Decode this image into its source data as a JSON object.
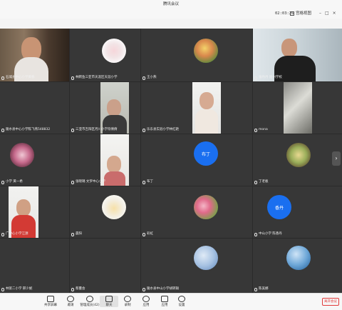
{
  "window": {
    "title": "腾讯会议"
  },
  "topbar": {
    "timer": "02:03:26",
    "view_label": "宫格视图"
  },
  "participants": {
    "r1c1": "石城县中心小学黄春",
    "r1c2": "林鳄鱼三亚市天涯区天涯小学",
    "r1c3": "王小燕",
    "r1c4": "张丹丹 崖州学校",
    "r2c1": "陵水县中心小学陈飞燕548832",
    "r2c2": "三亚市吉阳区月川小学符倩倩",
    "r2c3": "乐东县实验小学林红艳",
    "r2c4": "mona",
    "r3c1": "小学 黄一希",
    "r3c2": "张晓璐 文罗中心小学",
    "r3c3": "布丁",
    "r3c4": "丁老板",
    "r4c1": "广中心小学江源",
    "r4c2": "晨阳",
    "r4c3": "彩虹",
    "r4c4": "中山小学 陈香丹",
    "r5c1": "林第二小学 邢少妮",
    "r5c2": "蔡蔓会",
    "r5c3": "陵水县中山小学胡转辑",
    "r5c4": "陈美娜"
  },
  "avatar_text": {
    "r3c3": "布丁",
    "r4c4": "香丹"
  },
  "toolbar": {
    "items": [
      "共享屏幕",
      "邀请",
      "管理成员(42)",
      "聊天",
      "录制",
      "应用",
      "应用",
      "设置"
    ],
    "end_label": "离开会议"
  },
  "colors": {
    "avatar_blue": "#1a6ff0",
    "end_red": "#e23b3b",
    "tile_bg": "#373737"
  },
  "icons": [
    "screen-share-icon",
    "invite-icon",
    "members-icon",
    "chat-icon",
    "record-icon",
    "apps-icon",
    "settings-icon",
    "grid-view-icon",
    "microphone-icon",
    "chevron-right-icon"
  ]
}
